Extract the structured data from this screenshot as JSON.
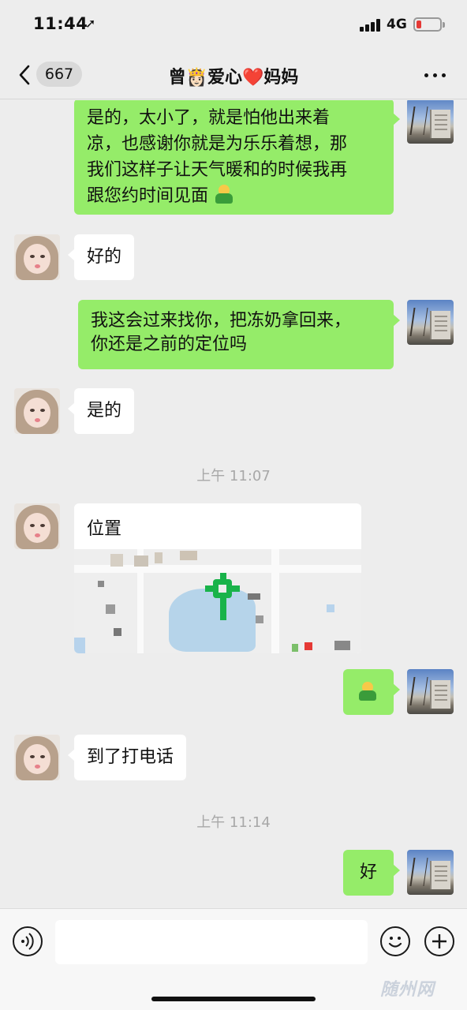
{
  "status_bar": {
    "time": "11:44",
    "network": "4G"
  },
  "nav": {
    "unread_count": "667",
    "title": "曾👸🏻爱心❤️妈妈"
  },
  "messages": [
    {
      "side": "self",
      "text": "是的，太小了，就是怕他出来着凉，也感谢你就是为乐乐着想，那我们这样子让天气暖和的时候我再跟您约时间见面",
      "trailing_emoji": "hug-emoji"
    },
    {
      "side": "other",
      "text": "好的"
    },
    {
      "side": "self",
      "text": "我这会过来找你，把冻奶拿回来，你还是之前的定位吗"
    },
    {
      "side": "other",
      "text": "是的"
    },
    {
      "type": "time",
      "text": "上午 11:07"
    },
    {
      "side": "other",
      "type": "location",
      "title": "位置"
    },
    {
      "side": "self",
      "type": "emoji",
      "emoji": "hug-emoji"
    },
    {
      "side": "other",
      "text": "到了打电话"
    },
    {
      "type": "time",
      "text": "上午 11:14"
    },
    {
      "side": "self",
      "text": "好"
    }
  ],
  "lines": {
    "m1": [
      "是的，太小了，就是怕他出来着",
      "凉，也感谢你就是为乐乐着想，那",
      "我们这样子让天气暖和的时候我再",
      "跟您约时间见面"
    ],
    "m3": [
      "我这会过来找你，把冻奶拿回来，",
      "你还是之前的定位吗"
    ]
  },
  "watermark": "随州网",
  "colors": {
    "self_bubble": "#95ec69",
    "other_bubble": "#ffffff",
    "background": "#ededed",
    "map_pin": "#19b34a"
  }
}
